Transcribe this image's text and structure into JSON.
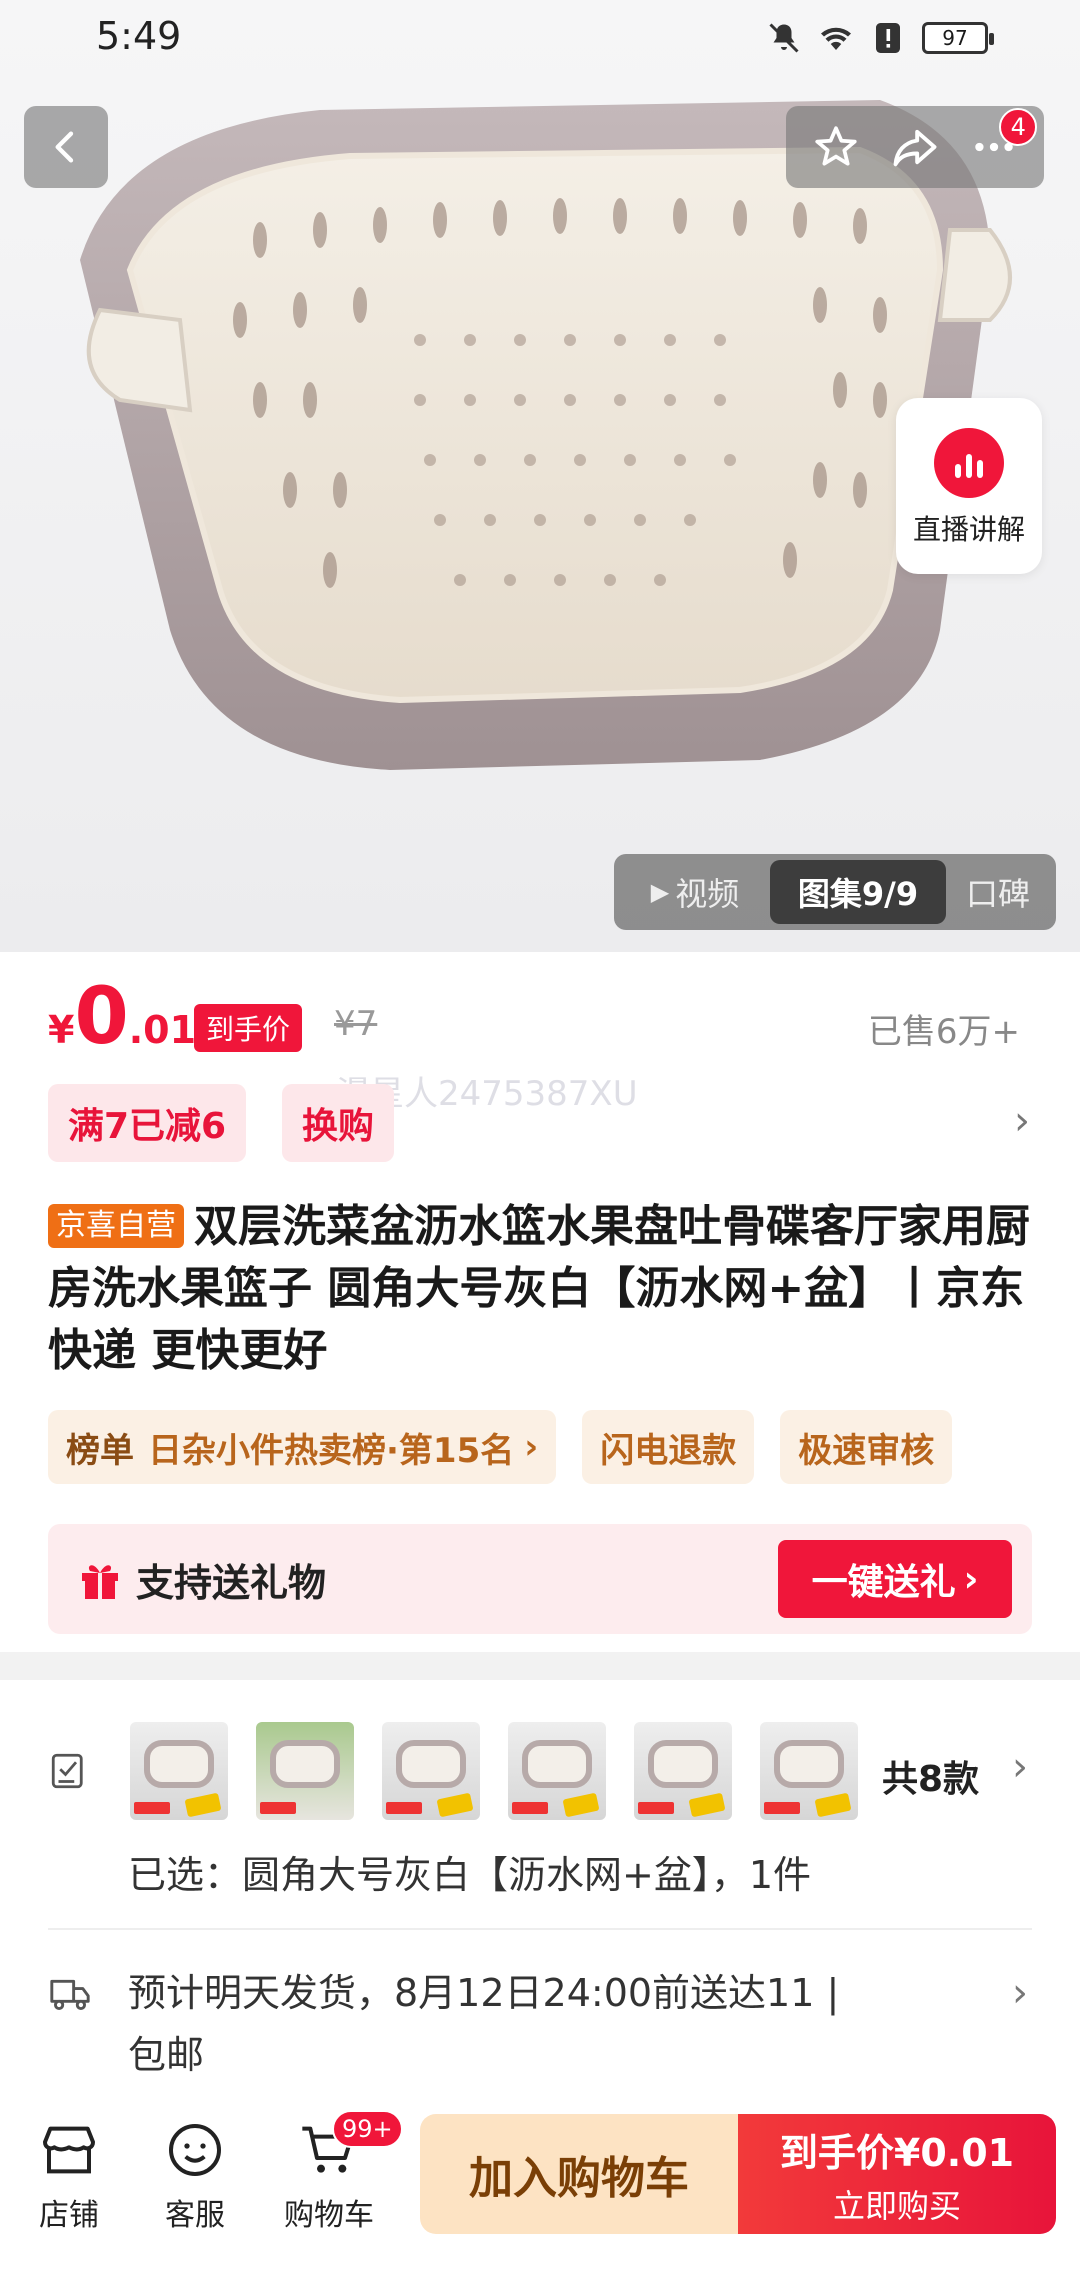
{
  "status_bar": {
    "time": "5:49",
    "battery": "97"
  },
  "top_actions": {
    "badge": "4"
  },
  "live": {
    "label": "直播讲解"
  },
  "media_tabs": {
    "video": "视频",
    "album": "图集9/9",
    "review": "口碑"
  },
  "price": {
    "currency": "¥",
    "integer": "0",
    "decimal": ".01",
    "tag": "到手价",
    "original": "¥7",
    "sold": "已售6万+"
  },
  "watermark": "漫星人2475387XU",
  "promos": [
    "满7已减6",
    "换购"
  ],
  "product": {
    "badge": "京喜自营",
    "title": "双层洗菜盆沥水篮水果盘吐骨碟客厅家用厨房洗水果篮子 圆角大号灰白【沥水网+盆】丨京东快递 更快更好"
  },
  "rank": {
    "label": "榜单",
    "text": "日杂小件热卖榜·第15名",
    "chips": [
      "闪电退款",
      "极速审核"
    ]
  },
  "gift": {
    "text": "支持送礼物",
    "button": "一键送礼"
  },
  "sku": {
    "count": "共8款",
    "selected": "已选：圆角大号灰白【沥水网+盆】，1件"
  },
  "shipping": {
    "text": "预计明天发货，8月12日24:00前送达11 | 包邮"
  },
  "bottom": {
    "shop": "店铺",
    "service": "客服",
    "cart": "购物车",
    "cart_badge": "99+",
    "add_cart": "加入购物车",
    "buy_line1": "到手价¥0.01",
    "buy_line2": "立即购买"
  },
  "colors": {
    "accent": "#f0163a",
    "badge_orange": "#ef6f15",
    "cart_btn": "#fde3c3"
  }
}
